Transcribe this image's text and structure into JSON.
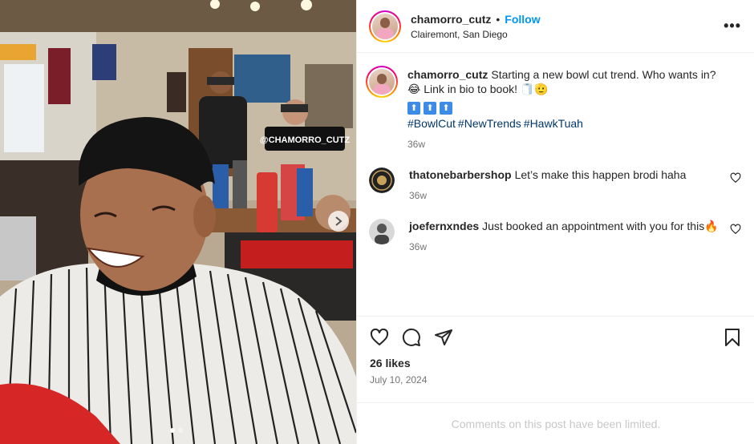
{
  "post": {
    "username": "chamorro_cutz",
    "separator": "•",
    "follow_label": "Follow",
    "location": "Clairemont, San Diego",
    "more_icon": "more-horizontal-icon"
  },
  "caption": {
    "username": "chamorro_cutz",
    "text": "Starting a new bowl cut trend. Who wants in? 😂 Link in bio to book! 🧻🫡",
    "emoji_row": [
      "⬆",
      "⬆",
      "⬆"
    ],
    "hashtags": [
      "#BowlCut",
      "#NewTrends",
      "#HawkTuah"
    ],
    "time": "36w"
  },
  "comments": [
    {
      "username": "thatonebarbershop",
      "text": "Let’s make this happen brodi haha",
      "time": "36w"
    },
    {
      "username": "joefernxndes",
      "text": "Just booked an appointment with you for this🔥",
      "time": "36w"
    }
  ],
  "actions": {
    "like_icon": "heart-icon",
    "comment_icon": "comment-icon",
    "share_icon": "share-icon",
    "save_icon": "bookmark-icon"
  },
  "likes": "26 likes",
  "date": "July 10, 2024",
  "comments_limited": "Comments on this post have been limited.",
  "photo": {
    "sign_text": "@CHAMORRO_CUTZ",
    "carousel_dots": 2,
    "active_dot": 0
  },
  "colors": {
    "link": "#0095f6",
    "hashtag": "#00376b",
    "muted": "#737373"
  }
}
